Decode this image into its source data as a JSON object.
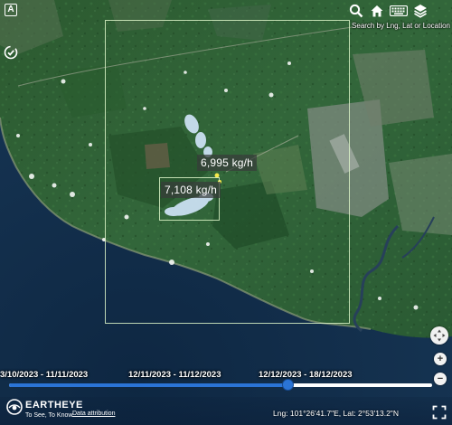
{
  "toolbar": {
    "search_hint": "Search by Lng, Lat or Location",
    "icons": [
      "search-icon",
      "home-icon",
      "keyboard-icon",
      "layers-icon"
    ],
    "left_icons": [
      "label-toggle-icon",
      "check-badge-icon"
    ],
    "left_label_glyph": "A"
  },
  "map": {
    "emissions": [
      {
        "value": "6,995 kg/h"
      },
      {
        "value": "7,108 kg/h"
      }
    ],
    "accent_color": "#2b74d6",
    "plume_color": "#d2e6fb"
  },
  "timeline": {
    "periods": [
      {
        "label": "3/10/2023 - 11/11/2023"
      },
      {
        "label": "12/11/2023 - 11/12/2023"
      },
      {
        "label": "12/12/2023 - 18/12/2023"
      }
    ],
    "selected_index": 1,
    "slider_position": 0.66
  },
  "brand": {
    "name": "EARTHEYE",
    "tagline": "To See, To Know.",
    "attribution_link": "Data attribution"
  },
  "status": {
    "coords": "Lng: 101°26'41.7\"E, Lat: 2°53'13.2\"N"
  },
  "zoom": {
    "in_label": "+",
    "out_label": "−"
  }
}
